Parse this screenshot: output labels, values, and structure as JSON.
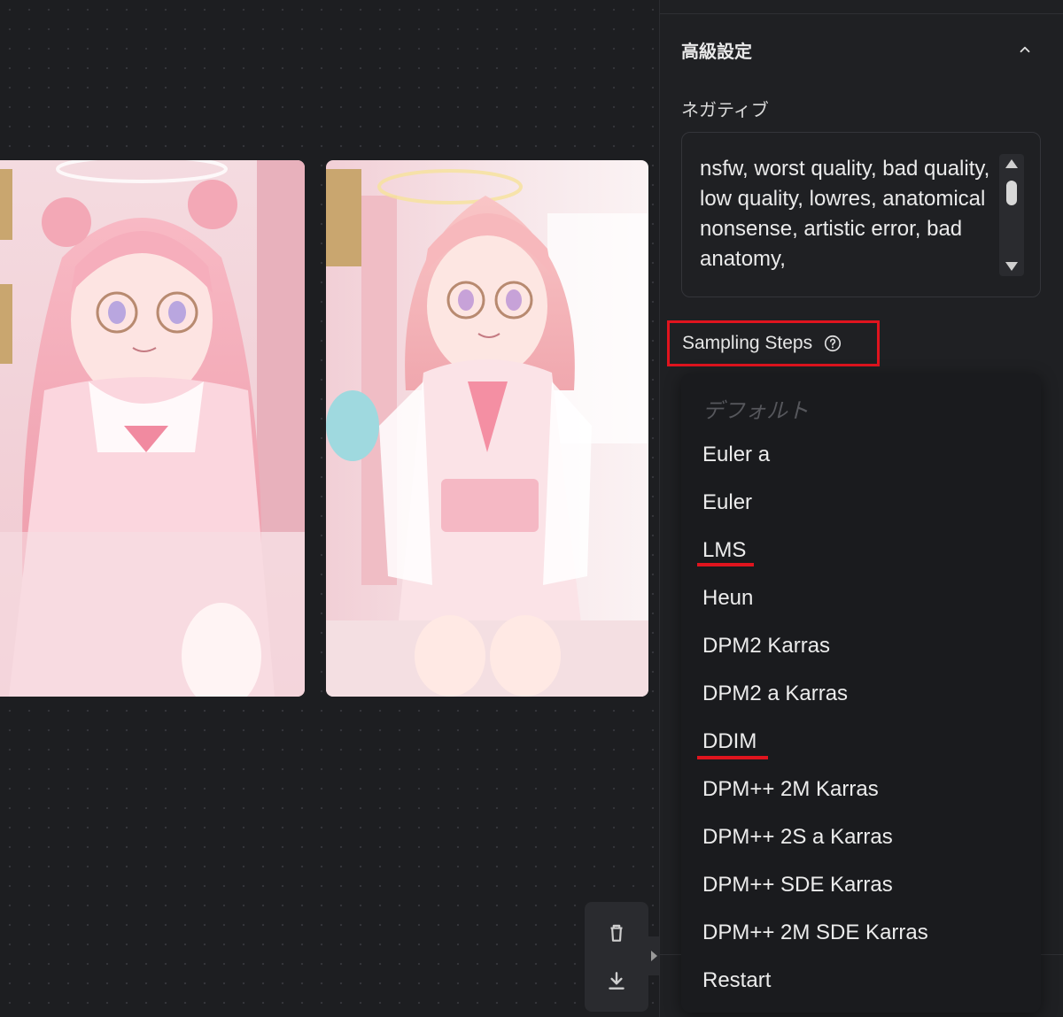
{
  "panel": {
    "section_title": "高級設定",
    "negative_label": "ネガティブ",
    "negative_text": "nsfw, worst quality, bad quality, low quality, lowres, anatomical nonsense, artistic error, bad anatomy,",
    "sampling_label": "Sampling Steps"
  },
  "dropdown": {
    "placeholder": "デフォルト",
    "options": [
      "Euler a",
      "Euler",
      "LMS",
      "Heun",
      "DPM2 Karras",
      "DPM2 a Karras",
      "DDIM",
      "DPM++ 2M Karras",
      "DPM++ 2S a Karras",
      "DPM++ SDE Karras",
      "DPM++ 2M SDE Karras",
      "Restart"
    ],
    "highlighted": [
      "LMS",
      "DDIM"
    ]
  },
  "colors": {
    "highlight_red": "#e0141e",
    "panel_bg": "#1f2023",
    "canvas_bg": "#1d1e21"
  },
  "icons": {
    "chevron": "chevron-up-icon",
    "help": "help-circle-icon",
    "delete": "trash-icon",
    "download": "download-icon"
  }
}
